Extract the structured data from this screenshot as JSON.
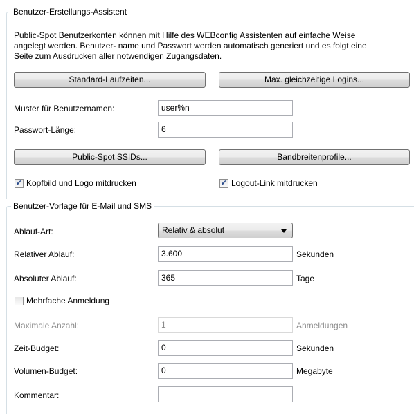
{
  "wizard": {
    "title": "Benutzer-Erstellungs-Assistent",
    "description_line1": "Public-Spot Benutzerkonten können mit Hilfe des WEBconfig Assistenten auf einfache Weise",
    "description_line2": "angelegt werden. Benutzer- name und Passwort werden automatisch generiert und es folgt eine",
    "description_line3": "Seite zum Ausdrucken aller notwendigen Zugangsdaten.",
    "btn_standard_runtimes": "Standard-Laufzeiten...",
    "btn_max_logins": "Max. gleichzeitige Logins...",
    "username_pattern_label": "Muster für Benutzernamen:",
    "username_pattern_value": "user%n",
    "password_length_label": "Passwort-Länge:",
    "password_length_value": "6",
    "btn_ssids": "Public-Spot SSIDs...",
    "btn_bandwidth": "Bandbreitenprofile...",
    "print_header_logo_label": "Kopfbild und Logo mitdrucken",
    "print_header_logo_checked": true,
    "print_logout_link_label": "Logout-Link mitdrucken",
    "print_logout_link_checked": true
  },
  "template": {
    "title": "Benutzer-Vorlage für E-Mail und SMS",
    "expiry_type_label": "Ablauf-Art:",
    "expiry_type_value": "Relativ & absolut",
    "relative_expiry_label": "Relativer Ablauf:",
    "relative_expiry_value": "3.600",
    "relative_expiry_unit": "Sekunden",
    "absolute_expiry_label": "Absoluter Ablauf:",
    "absolute_expiry_value": "365",
    "absolute_expiry_unit": "Tage",
    "multiple_login_label": "Mehrfache Anmeldung",
    "multiple_login_checked": false,
    "max_count_label": "Maximale Anzahl:",
    "max_count_value": "1",
    "max_count_unit": "Anmeldungen",
    "time_budget_label": "Zeit-Budget:",
    "time_budget_value": "0",
    "time_budget_unit": "Sekunden",
    "volume_budget_label": "Volumen-Budget:",
    "volume_budget_value": "0",
    "volume_budget_unit": "Megabyte",
    "comment_label": "Kommentar:",
    "comment_value": ""
  },
  "icons": {
    "checkmark": "✔"
  }
}
